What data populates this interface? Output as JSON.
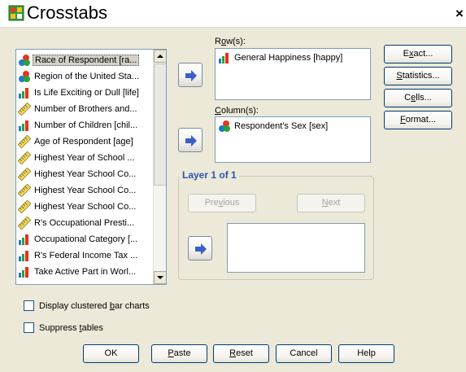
{
  "window": {
    "title": "Crosstabs",
    "close_glyph": "×"
  },
  "source_vars": [
    {
      "label": "Race of Respondent [ra...",
      "icon": "nominal-icon",
      "selected": true
    },
    {
      "label": "Region of the United Sta...",
      "icon": "nominal-icon"
    },
    {
      "label": "Is Life Exciting or Dull [life]",
      "icon": "ordinal-icon"
    },
    {
      "label": "Number of Brothers and...",
      "icon": "scale-icon"
    },
    {
      "label": "Number of Children [chil...",
      "icon": "ordinal-icon"
    },
    {
      "label": "Age of Respondent [age]",
      "icon": "scale-icon"
    },
    {
      "label": "Highest Year of School ...",
      "icon": "scale-icon"
    },
    {
      "label": "Highest Year School Co...",
      "icon": "scale-icon"
    },
    {
      "label": "Highest Year School Co...",
      "icon": "scale-icon"
    },
    {
      "label": "Highest Year School Co...",
      "icon": "scale-icon"
    },
    {
      "label": "R's Occupational Presti...",
      "icon": "scale-icon"
    },
    {
      "label": "Occupational Category [...",
      "icon": "ordinal-icon"
    },
    {
      "label": "R's Federal Income Tax ...",
      "icon": "ordinal-icon"
    },
    {
      "label": "Take Active Part in Worl...",
      "icon": "ordinal-icon"
    }
  ],
  "rows": {
    "label_pre": "R",
    "label_key": "o",
    "label_post": "w(s):",
    "item": "General Happiness [happy]",
    "icon": "ordinal-icon"
  },
  "columns": {
    "label_pre": "",
    "label_key": "C",
    "label_post": "olumn(s):",
    "item": "Respondent's Sex [sex]",
    "icon": "nominal-icon"
  },
  "layer": {
    "title": "Layer 1 of 1",
    "previous": {
      "pre": "Pre",
      "key": "v",
      "post": "ious"
    },
    "next": {
      "pre": "",
      "key": "N",
      "post": "ext"
    }
  },
  "side_buttons": [
    {
      "pre": "E",
      "key": "x",
      "post": "act..."
    },
    {
      "pre": "",
      "key": "S",
      "post": "tatistics..."
    },
    {
      "pre": "C",
      "key": "e",
      "post": "lls..."
    },
    {
      "pre": "",
      "key": "F",
      "post": "ormat..."
    }
  ],
  "options": {
    "clustered": {
      "pre": "Display clustered ",
      "key": "b",
      "post": "ar charts",
      "checked": false
    },
    "suppress": {
      "pre": "Suppress ",
      "key": "t",
      "post": "ables",
      "checked": false
    }
  },
  "bottom_buttons": [
    {
      "pre": "OK",
      "key": "",
      "post": ""
    },
    {
      "pre": "",
      "key": "P",
      "post": "aste"
    },
    {
      "pre": "",
      "key": "R",
      "post": "eset"
    },
    {
      "pre": "Cancel",
      "key": "",
      "post": ""
    },
    {
      "pre": "Help",
      "key": "",
      "post": ""
    }
  ],
  "colors": {
    "accent_blue": "#2a53b4",
    "move_arrow": "#3a5fc8",
    "dialog_bg": "#ece9d8"
  }
}
